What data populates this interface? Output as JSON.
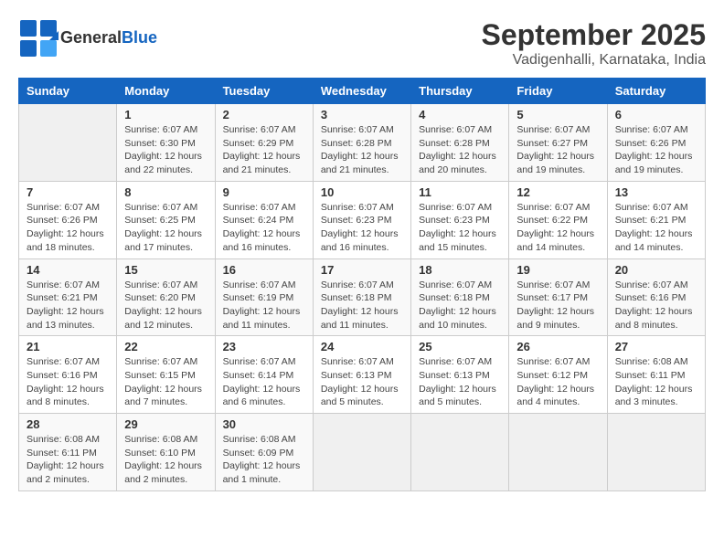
{
  "logo": {
    "general": "General",
    "blue": "Blue"
  },
  "title": "September 2025",
  "subtitle": "Vadigenhalli, Karnataka, India",
  "weekdays": [
    "Sunday",
    "Monday",
    "Tuesday",
    "Wednesday",
    "Thursday",
    "Friday",
    "Saturday"
  ],
  "weeks": [
    [
      {
        "day": "",
        "info": ""
      },
      {
        "day": "1",
        "info": "Sunrise: 6:07 AM\nSunset: 6:30 PM\nDaylight: 12 hours\nand 22 minutes."
      },
      {
        "day": "2",
        "info": "Sunrise: 6:07 AM\nSunset: 6:29 PM\nDaylight: 12 hours\nand 21 minutes."
      },
      {
        "day": "3",
        "info": "Sunrise: 6:07 AM\nSunset: 6:28 PM\nDaylight: 12 hours\nand 21 minutes."
      },
      {
        "day": "4",
        "info": "Sunrise: 6:07 AM\nSunset: 6:28 PM\nDaylight: 12 hours\nand 20 minutes."
      },
      {
        "day": "5",
        "info": "Sunrise: 6:07 AM\nSunset: 6:27 PM\nDaylight: 12 hours\nand 19 minutes."
      },
      {
        "day": "6",
        "info": "Sunrise: 6:07 AM\nSunset: 6:26 PM\nDaylight: 12 hours\nand 19 minutes."
      }
    ],
    [
      {
        "day": "7",
        "info": "Sunrise: 6:07 AM\nSunset: 6:26 PM\nDaylight: 12 hours\nand 18 minutes."
      },
      {
        "day": "8",
        "info": "Sunrise: 6:07 AM\nSunset: 6:25 PM\nDaylight: 12 hours\nand 17 minutes."
      },
      {
        "day": "9",
        "info": "Sunrise: 6:07 AM\nSunset: 6:24 PM\nDaylight: 12 hours\nand 16 minutes."
      },
      {
        "day": "10",
        "info": "Sunrise: 6:07 AM\nSunset: 6:23 PM\nDaylight: 12 hours\nand 16 minutes."
      },
      {
        "day": "11",
        "info": "Sunrise: 6:07 AM\nSunset: 6:23 PM\nDaylight: 12 hours\nand 15 minutes."
      },
      {
        "day": "12",
        "info": "Sunrise: 6:07 AM\nSunset: 6:22 PM\nDaylight: 12 hours\nand 14 minutes."
      },
      {
        "day": "13",
        "info": "Sunrise: 6:07 AM\nSunset: 6:21 PM\nDaylight: 12 hours\nand 14 minutes."
      }
    ],
    [
      {
        "day": "14",
        "info": "Sunrise: 6:07 AM\nSunset: 6:21 PM\nDaylight: 12 hours\nand 13 minutes."
      },
      {
        "day": "15",
        "info": "Sunrise: 6:07 AM\nSunset: 6:20 PM\nDaylight: 12 hours\nand 12 minutes."
      },
      {
        "day": "16",
        "info": "Sunrise: 6:07 AM\nSunset: 6:19 PM\nDaylight: 12 hours\nand 11 minutes."
      },
      {
        "day": "17",
        "info": "Sunrise: 6:07 AM\nSunset: 6:18 PM\nDaylight: 12 hours\nand 11 minutes."
      },
      {
        "day": "18",
        "info": "Sunrise: 6:07 AM\nSunset: 6:18 PM\nDaylight: 12 hours\nand 10 minutes."
      },
      {
        "day": "19",
        "info": "Sunrise: 6:07 AM\nSunset: 6:17 PM\nDaylight: 12 hours\nand 9 minutes."
      },
      {
        "day": "20",
        "info": "Sunrise: 6:07 AM\nSunset: 6:16 PM\nDaylight: 12 hours\nand 8 minutes."
      }
    ],
    [
      {
        "day": "21",
        "info": "Sunrise: 6:07 AM\nSunset: 6:16 PM\nDaylight: 12 hours\nand 8 minutes."
      },
      {
        "day": "22",
        "info": "Sunrise: 6:07 AM\nSunset: 6:15 PM\nDaylight: 12 hours\nand 7 minutes."
      },
      {
        "day": "23",
        "info": "Sunrise: 6:07 AM\nSunset: 6:14 PM\nDaylight: 12 hours\nand 6 minutes."
      },
      {
        "day": "24",
        "info": "Sunrise: 6:07 AM\nSunset: 6:13 PM\nDaylight: 12 hours\nand 5 minutes."
      },
      {
        "day": "25",
        "info": "Sunrise: 6:07 AM\nSunset: 6:13 PM\nDaylight: 12 hours\nand 5 minutes."
      },
      {
        "day": "26",
        "info": "Sunrise: 6:07 AM\nSunset: 6:12 PM\nDaylight: 12 hours\nand 4 minutes."
      },
      {
        "day": "27",
        "info": "Sunrise: 6:08 AM\nSunset: 6:11 PM\nDaylight: 12 hours\nand 3 minutes."
      }
    ],
    [
      {
        "day": "28",
        "info": "Sunrise: 6:08 AM\nSunset: 6:11 PM\nDaylight: 12 hours\nand 2 minutes."
      },
      {
        "day": "29",
        "info": "Sunrise: 6:08 AM\nSunset: 6:10 PM\nDaylight: 12 hours\nand 2 minutes."
      },
      {
        "day": "30",
        "info": "Sunrise: 6:08 AM\nSunset: 6:09 PM\nDaylight: 12 hours\nand 1 minute."
      },
      {
        "day": "",
        "info": ""
      },
      {
        "day": "",
        "info": ""
      },
      {
        "day": "",
        "info": ""
      },
      {
        "day": "",
        "info": ""
      }
    ]
  ]
}
